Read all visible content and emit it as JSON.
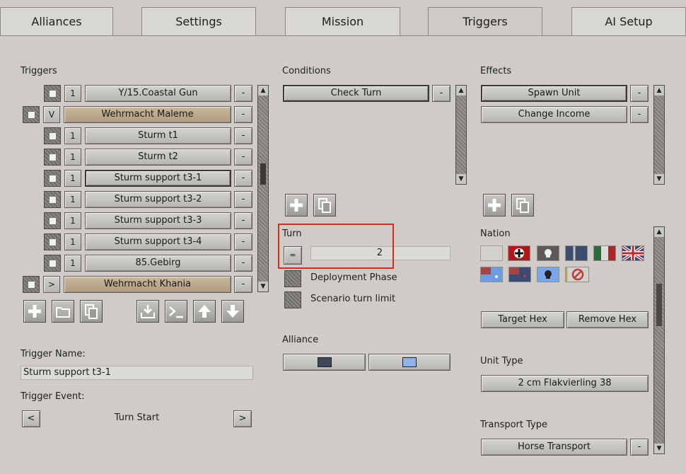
{
  "tabs": [
    "Alliances",
    "Settings",
    "Mission",
    "Triggers",
    "AI Setup"
  ],
  "triggers_panel": {
    "heading": "Triggers",
    "rows": [
      {
        "count": "1",
        "label": "Y/15.Coastal Gun"
      },
      {
        "toggle": "V",
        "label": "Wehrmacht Maleme",
        "group": true
      },
      {
        "count": "1",
        "label": "Sturm t1"
      },
      {
        "count": "1",
        "label": "Sturm t2"
      },
      {
        "count": "1",
        "label": "Sturm support t3-1",
        "selected": true
      },
      {
        "count": "1",
        "label": "Sturm support t3-2"
      },
      {
        "count": "1",
        "label": "Sturm support t3-3"
      },
      {
        "count": "1",
        "label": "Sturm support t3-4"
      },
      {
        "count": "1",
        "label": "85.Gebirg"
      },
      {
        "toggle": ">",
        "label": "Wehrmacht Khania",
        "group": true
      }
    ],
    "remove_label": "-",
    "toolbar_icons": [
      "add-icon",
      "folder-icon",
      "copy-icon",
      "import-icon",
      "console-icon",
      "move-up-icon",
      "move-down-icon"
    ],
    "trigger_name_label": "Trigger Name:",
    "trigger_name_value": "Sturm support t3-1",
    "trigger_event_label": "Trigger Event:",
    "trigger_event_value": "Turn Start",
    "prev": "<",
    "next": ">"
  },
  "conditions": {
    "heading": "Conditions",
    "items": [
      "Check Turn"
    ],
    "remove_label": "-"
  },
  "turn": {
    "heading": "Turn",
    "operator": "=",
    "value": "2",
    "deployment_phase": "Deployment Phase",
    "scenario_turn_limit": "Scenario turn limit"
  },
  "alliance": {
    "heading": "Alliance",
    "colors": [
      "#3d4a5c",
      "#8fb4ea"
    ]
  },
  "effects": {
    "heading": "Effects",
    "items": [
      "Spawn Unit",
      "Change Income"
    ],
    "remove_label": "-"
  },
  "nation": {
    "heading": "Nation",
    "flags": [
      "neutral-flag",
      "germany-flag",
      "finland-skull-flag",
      "soviet-flag",
      "italy-flag",
      "uk-flag",
      "australia-flag",
      "nz-flag",
      "yugoslavia-flag",
      "greece-flag",
      "none-flag"
    ],
    "target_hex": "Target Hex",
    "remove_hex": "Remove Hex"
  },
  "unit_type": {
    "heading": "Unit Type",
    "value": "2 cm Flakvierling 38"
  },
  "transport_type": {
    "heading": "Transport Type",
    "value": "Horse Transport",
    "remove_label": "-"
  },
  "colors": {
    "highlight": "#e0261d",
    "background": "#cfccc7"
  }
}
